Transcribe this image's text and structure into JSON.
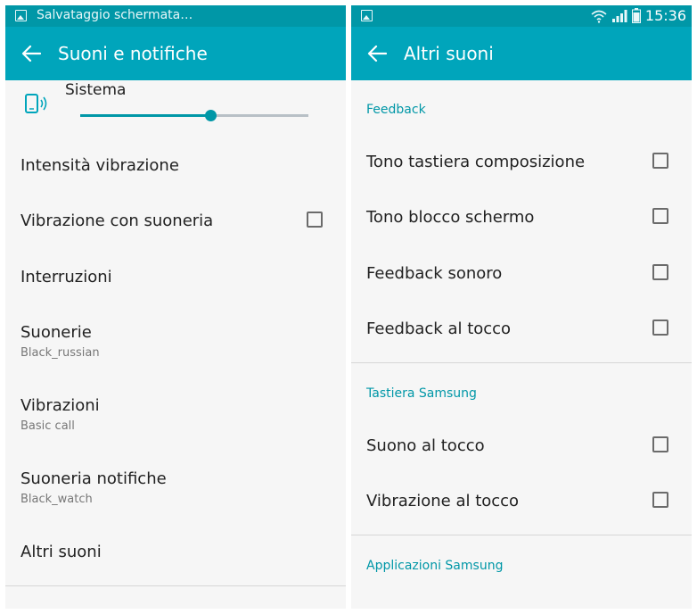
{
  "colors": {
    "accent": "#00a5bb",
    "status_bar": "#0097a7",
    "section_header": "#0097a7"
  },
  "left": {
    "status_text": "Salvataggio schermata…",
    "title": "Suoni e notifiche",
    "volume": {
      "label": "Sistema",
      "level": 0.57
    },
    "items": [
      {
        "title": "Intensità vibrazione"
      },
      {
        "title": "Vibrazione con suoneria"
      },
      {
        "title": "Interruzioni"
      },
      {
        "title": "Suonerie",
        "subtitle": "Black_russian"
      },
      {
        "title": "Vibrazioni",
        "subtitle": "Basic call"
      },
      {
        "title": "Suoneria notifiche",
        "subtitle": "Black_watch"
      },
      {
        "title": "Altri suoni"
      }
    ]
  },
  "right": {
    "status_time": "15:36",
    "title": "Altri suoni",
    "sections": [
      {
        "header": "Feedback",
        "items": [
          "Tono tastiera composizione",
          "Tono blocco schermo",
          "Feedback sonoro",
          "Feedback al tocco"
        ]
      },
      {
        "header": "Tastiera Samsung",
        "items": [
          "Suono al tocco",
          "Vibrazione al tocco"
        ]
      },
      {
        "header": "Applicazioni Samsung",
        "items": []
      }
    ]
  }
}
